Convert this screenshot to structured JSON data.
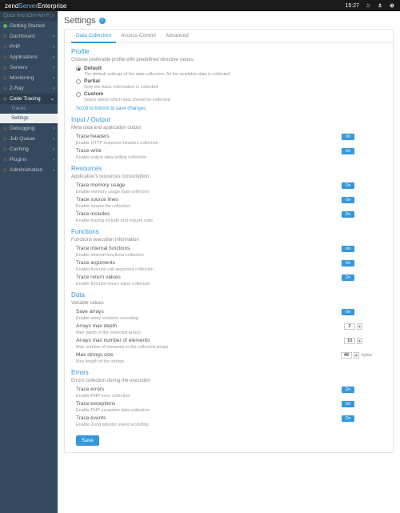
{
  "topbar": {
    "brand_prefix": "zend",
    "brand_mid": "Server",
    "brand_suffix": "Enterprise",
    "time": "15:27"
  },
  "sidebar": {
    "quickfind": "Quick find (Ctrl+Alt+F)",
    "items": [
      {
        "label": "Getting Started"
      },
      {
        "label": "Dashboard"
      },
      {
        "label": "PHP"
      },
      {
        "label": "Applications"
      },
      {
        "label": "Servers"
      },
      {
        "label": "Monitoring"
      },
      {
        "label": "Z-Ray"
      },
      {
        "label": "Code Tracing"
      },
      {
        "label": "Debugging"
      },
      {
        "label": "Job Queue"
      },
      {
        "label": "Caching"
      },
      {
        "label": "Plugins"
      },
      {
        "label": "Administration"
      }
    ],
    "sub": {
      "traces": "Traces",
      "settings": "Settings"
    }
  },
  "page": {
    "title": "Settings"
  },
  "tabs": {
    "data_collection": "Data Collection",
    "access_control": "Access Control",
    "advanced": "Advanced"
  },
  "profile": {
    "title": "Profile",
    "sub": "Choose preferable profile with predefined directive values",
    "opt_default": "Default",
    "opt_default_desc": "The default settings of the data collection. All the available data is collected",
    "opt_partial": "Partial",
    "opt_partial_desc": "Only the basic information is collected",
    "opt_custom": "Custom",
    "opt_custom_desc": "Select below which data should be collected",
    "scroll": "Scroll to bottom to save changes"
  },
  "io": {
    "title": "Input / Output",
    "sub": "Meta data and application output",
    "r1": "Trace headers",
    "r1d": "Enable HTTP response headers collection",
    "r2": "Trace write",
    "r2d": "Enable output data writing collection"
  },
  "res": {
    "title": "Resources",
    "sub": "Application's resources consumption",
    "r1": "Trace memory usage",
    "r1d": "Enable memory usage data collection",
    "r2": "Trace source lines",
    "r2d": "Enable source file collection",
    "r3": "Trace includes",
    "r3d": "Enable tracing include and require calls"
  },
  "fn": {
    "title": "Functions",
    "sub": "Functions execution information",
    "r1": "Trace internal functions",
    "r1d": "Enable internal functions collection",
    "r2": "Trace arguments",
    "r2d": "Enable function call argument collection",
    "r3": "Trace return values",
    "r3d": "Enable function return value collection"
  },
  "data": {
    "title": "Data",
    "sub": "Variable values",
    "r1": "Save arrays",
    "r1d": "Enable array contents recording",
    "r2": "Arrays max depth",
    "r2d": "Max depth of the collected arrays",
    "r2v": "2",
    "r3": "Arrays max number of elements",
    "r3d": "Max number of elements in the collected arrays",
    "r3v": "10",
    "r4": "Max strings size",
    "r4d": "Max length of the strings",
    "r4v": "48",
    "r4u": "bytes"
  },
  "err": {
    "title": "Errors",
    "sub": "Errors collection during the execution",
    "r1": "Trace errors",
    "r1d": "Enable PHP error collection",
    "r2": "Trace exceptions",
    "r2d": "Enable PHP exception data collection",
    "r3": "Trace events",
    "r3d": "Enable Zend Monitor event recording"
  },
  "toggle_on": "On",
  "save": "Save"
}
